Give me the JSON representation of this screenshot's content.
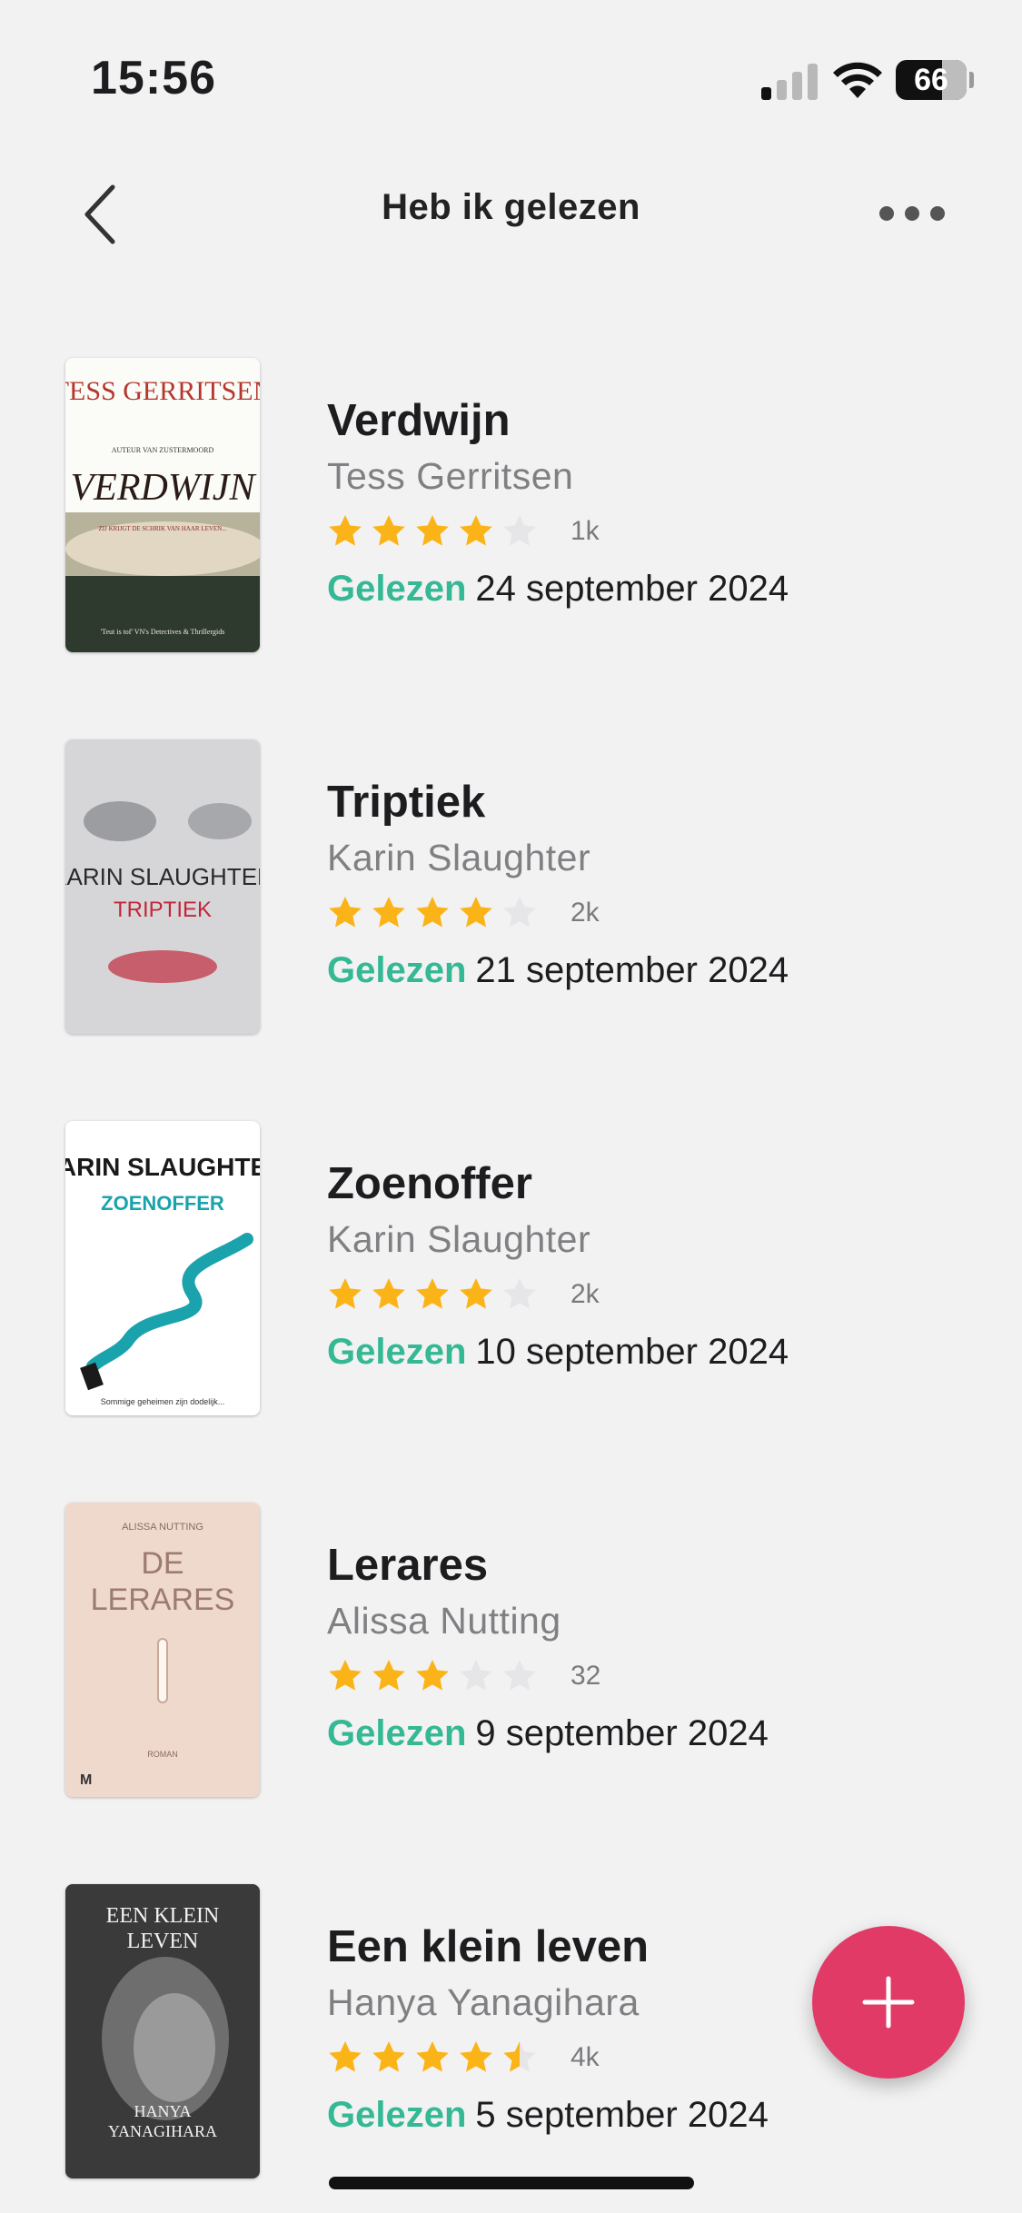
{
  "status_bar": {
    "time": "15:56",
    "battery": "66",
    "battery_level": 0.66
  },
  "nav": {
    "title": "Heb ik gelezen"
  },
  "read_label": "Gelezen",
  "books": [
    {
      "title": "Verdwijn",
      "author": "Tess Gerritsen",
      "rating": 4,
      "rating_count": "1k",
      "read_date": "24 september 2024",
      "cover": {
        "author_text": "TESS GERRITSEN",
        "title_text": "VERDWIJN",
        "tagline": "AUTEUR VAN ZUSTERMOORD",
        "subline": "ZIJ KRIJGT DE SCHRIK VAN HAAR LEVEN...",
        "quote": "'Teut is tof' VN's Detectives & Thrillergids"
      }
    },
    {
      "title": "Triptiek",
      "author": "Karin Slaughter",
      "rating": 4,
      "rating_count": "2k",
      "read_date": "21 september 2024",
      "cover": {
        "author_text": "KARIN SLAUGHTER",
        "title_text": "TRIPTIEK"
      }
    },
    {
      "title": "Zoenoffer",
      "author": "Karin Slaughter",
      "rating": 4,
      "rating_count": "2k",
      "read_date": "10 september 2024",
      "cover": {
        "author_text": "KARIN SLAUGHTER",
        "title_text": "ZOENOFFER",
        "subline": "Sommige geheimen zijn dodelijk..."
      }
    },
    {
      "title": "Lerares",
      "author": "Alissa Nutting",
      "rating": 3,
      "rating_count": "32",
      "read_date": "9 september 2024",
      "cover": {
        "author_text": "ALISSA NUTTING",
        "title_text": "DE LERARES",
        "subline": "ROMAN"
      }
    },
    {
      "title": "Een klein leven",
      "author": "Hanya Yanagihara",
      "rating": 4.5,
      "rating_count": "4k",
      "read_date": "5 september 2024",
      "cover": {
        "author_text": "HANYA YANAGIHARA",
        "title_text": "EEN KLEIN LEVEN"
      }
    }
  ],
  "colors": {
    "accent_green": "#35b894",
    "star": "#fbb417",
    "star_empty": "#e6e6e8",
    "fab": "#e23a66",
    "background": "#f2f2f3"
  },
  "icons": {
    "back": "chevron-left-icon",
    "more": "ellipsis-icon",
    "add": "plus-icon"
  }
}
